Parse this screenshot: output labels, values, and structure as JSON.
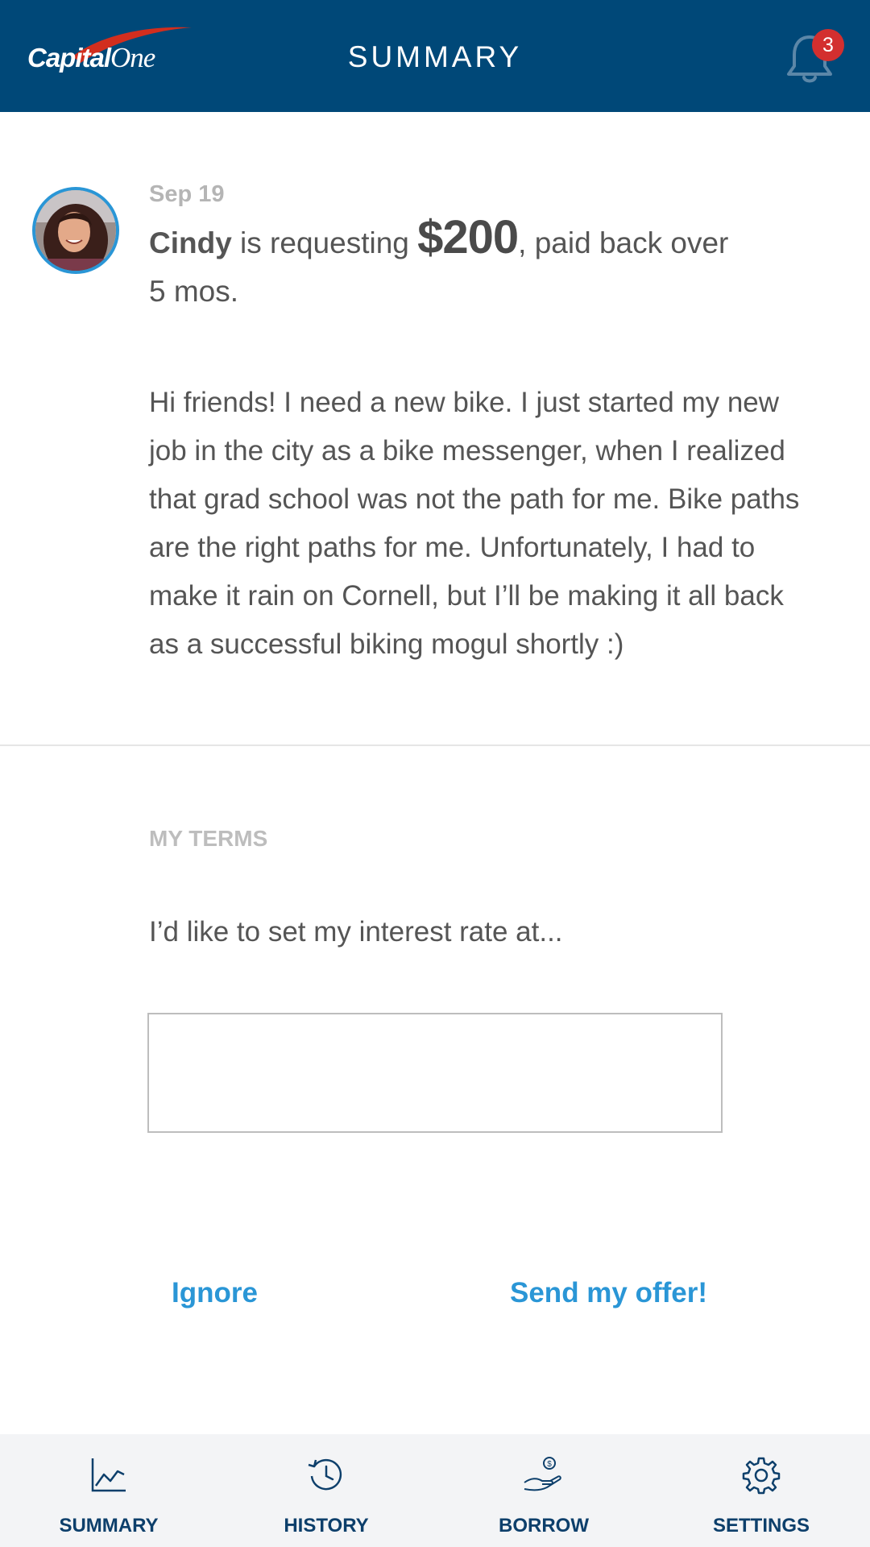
{
  "header": {
    "logo_text_main": "Capital",
    "logo_text_one": "One",
    "title": "SUMMARY",
    "notification_count": "3"
  },
  "request": {
    "date": "Sep 19",
    "name": "Cindy",
    "verb": " is requesting ",
    "amount": "$200",
    "tail": ", paid back over",
    "term": "5 mos.",
    "message": "Hi friends! I need a new bike. I just started my new job in the city as a bike messenger, when I realized that grad school was not the path for me. Bike paths are the right paths for me. Unfortunately, I had to make it rain on Cornell, but I’ll be making it all back as a successful biking mogul shortly :)"
  },
  "terms": {
    "label": "MY TERMS",
    "prompt": "I’d like to set my interest rate at...",
    "rate_value": ""
  },
  "actions": {
    "ignore_label": "Ignore",
    "send_label": "Send my offer!"
  },
  "nav": {
    "items": [
      {
        "label": "SUMMARY",
        "icon": "chart-icon"
      },
      {
        "label": "HISTORY",
        "icon": "history-icon"
      },
      {
        "label": "BORROW",
        "icon": "hand-money-icon"
      },
      {
        "label": "SETTINGS",
        "icon": "gear-icon"
      }
    ]
  },
  "colors": {
    "header_bg": "#004878",
    "accent": "#2a96d6",
    "badge": "#d32f2f",
    "nav_text": "#0d3f6b"
  }
}
